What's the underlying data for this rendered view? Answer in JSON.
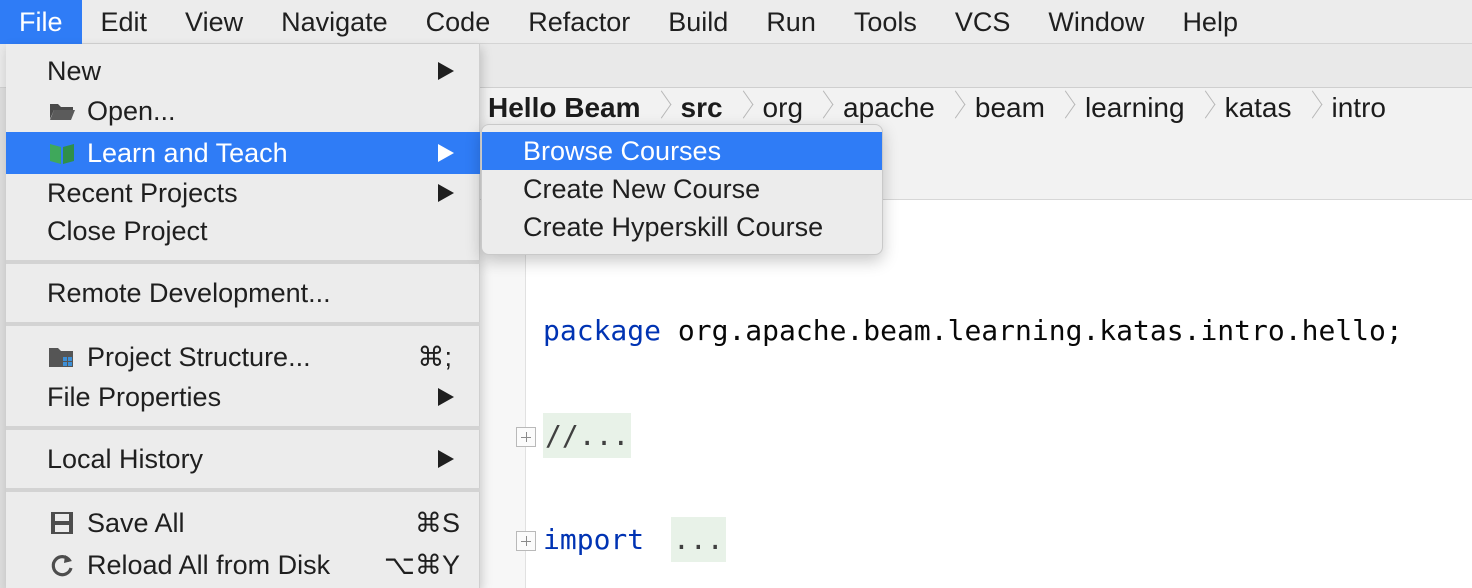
{
  "menubar": {
    "items": [
      "File",
      "Edit",
      "View",
      "Navigate",
      "Code",
      "Refactor",
      "Build",
      "Run",
      "Tools",
      "VCS",
      "Window",
      "Help"
    ],
    "active": "File"
  },
  "breadcrumb": {
    "items": [
      "Hello Beam",
      "src",
      "org",
      "apache",
      "beam",
      "learning",
      "katas",
      "intro"
    ]
  },
  "editor": {
    "line1_keyword": "package",
    "line1_text": " org.apache.beam.learning.katas.intro.hello;",
    "line2_folded": "//...",
    "line3_keyword": "import",
    "line3_folded": "..."
  },
  "file_menu": {
    "new": "New",
    "open": "Open...",
    "learn_and_teach": "Learn and Teach",
    "recent_projects": "Recent Projects",
    "close_project": "Close Project",
    "remote_development": "Remote Development...",
    "project_structure": "Project Structure...",
    "project_structure_shortcut": "⌘;",
    "file_properties": "File Properties",
    "local_history": "Local History",
    "save_all": "Save All",
    "save_all_shortcut": "⌘S",
    "reload_all": "Reload All from Disk",
    "reload_all_shortcut": "⌥⌘Y"
  },
  "submenu": {
    "browse_courses": "Browse Courses",
    "create_new_course": "Create New Course",
    "create_hyperskill_course": "Create Hyperskill Course"
  },
  "colors": {
    "highlight": "#2f7cf6",
    "keyword": "#0033b3",
    "fold_background": "#e8f2e8",
    "menu_background": "#ececec"
  },
  "icons": {
    "open": "folder-icon",
    "learn_and_teach": "book-icon",
    "project_structure": "project-structure-icon",
    "save_all": "save-icon",
    "reload_all": "reload-icon"
  }
}
